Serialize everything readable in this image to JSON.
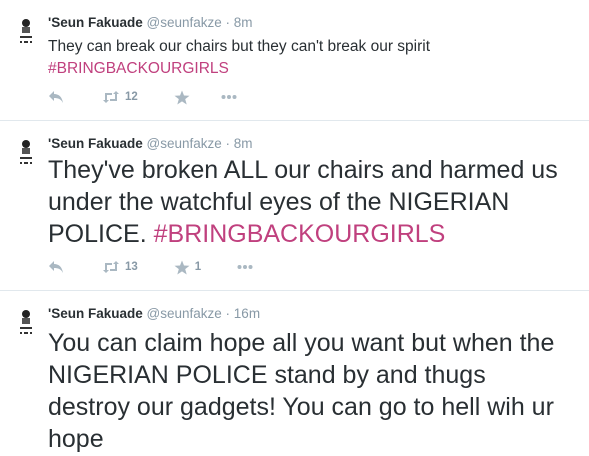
{
  "tweets": [
    {
      "name": "'Seun Fakuade",
      "handle": "@seunfakze",
      "separator": "·",
      "time": "8m",
      "text": "They can break our chairs but they can't break our spirit",
      "hashtag": "#BRINGBACKOURGIRLS",
      "retweets": "12",
      "favorites": ""
    },
    {
      "name": "'Seun Fakuade",
      "handle": "@seunfakze",
      "separator": "·",
      "time": "8m",
      "text_lines": [
        "They've broken ALL our chairs and harmed us",
        "under the watchful eyes of the NIGERIAN",
        "POLICE."
      ],
      "hashtag": "#BRINGBACKOURGIRLS",
      "retweets": "13",
      "favorites": "1"
    },
    {
      "name": "'Seun Fakuade",
      "handle": "@seunfakze",
      "separator": "·",
      "time": "16m",
      "text_lines": [
        "You can claim hope all you want but when the",
        "NIGERIAN POLICE stand by and thugs",
        "destroy our gadgets! You can go to hell wih ur",
        "hope"
      ]
    }
  ],
  "icons": {
    "reply": "reply-icon",
    "retweet": "retweet-icon",
    "favorite": "star-icon",
    "more": "more-icon",
    "avatar": "avatar-icon"
  },
  "colors": {
    "hashtag": "#c0407e",
    "meta": "#8899a6",
    "icon": "#aab8c2",
    "border": "#e1e8ed"
  }
}
